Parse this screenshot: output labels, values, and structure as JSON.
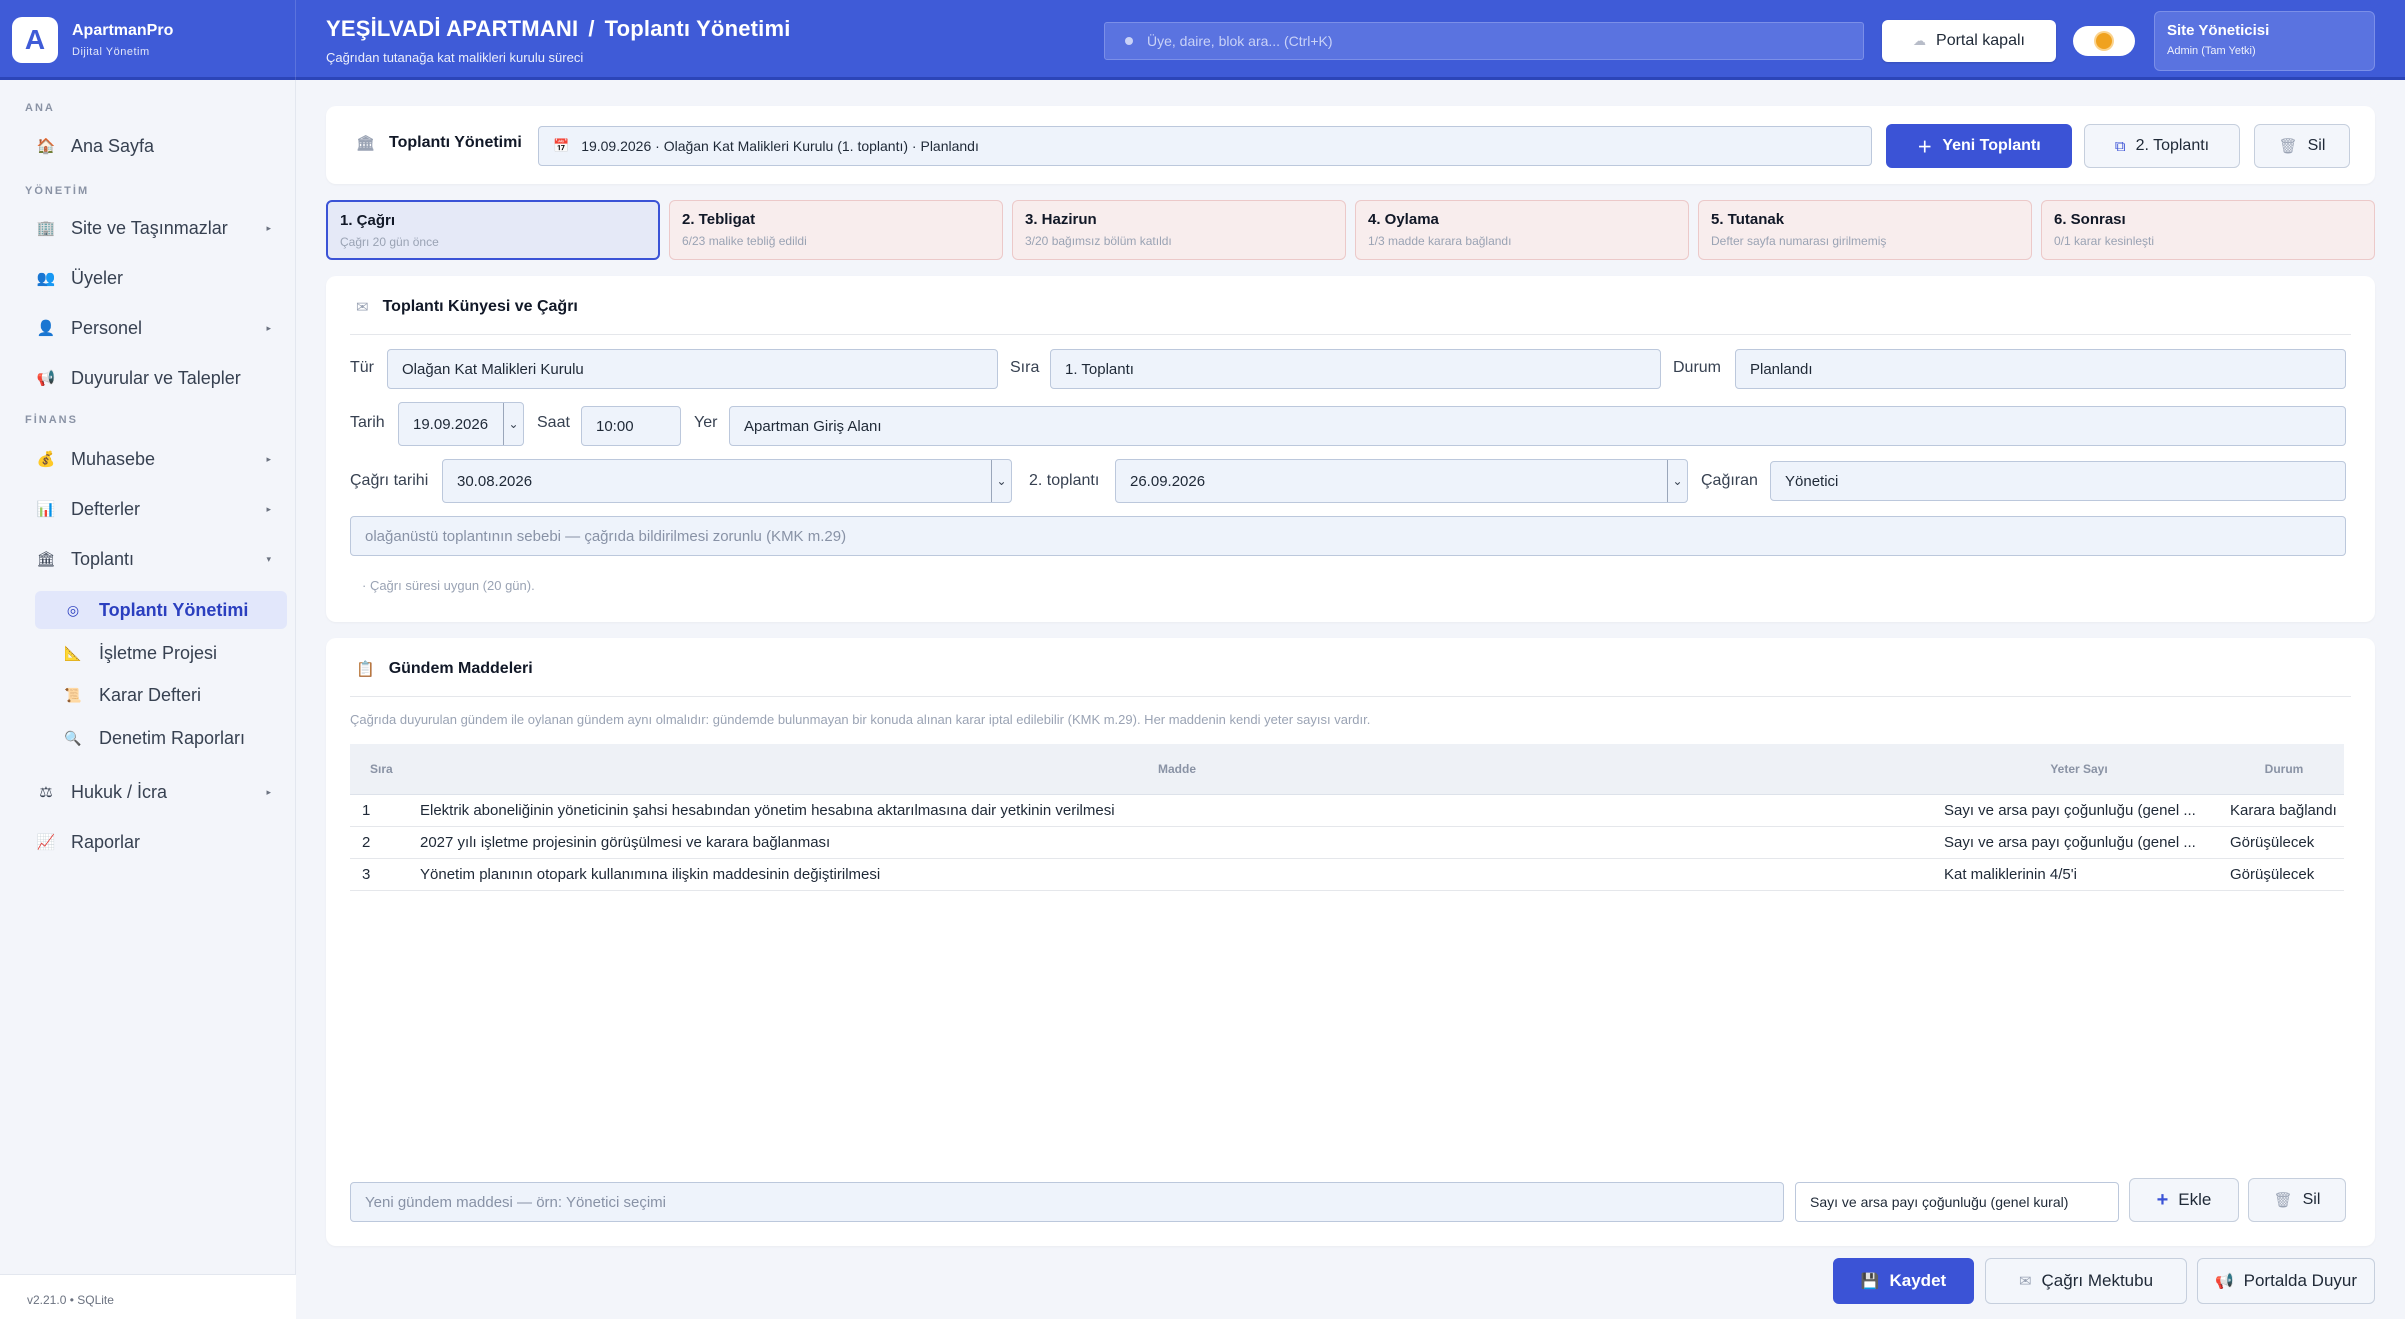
{
  "brand": {
    "logo": "A",
    "name": "ApartmanPro",
    "subtitle": "Dijital Yönetim"
  },
  "header": {
    "title_site": "YEŞİLVADİ APARTMANI",
    "title_sep": "/",
    "title_page": "Toplantı Yönetimi",
    "subtitle": "Çağrıdan tutanağa kat malikleri kurulu süreci",
    "search_placeholder": "Üye, daire, blok ara...  (Ctrl+K)",
    "portal_label": "Portal kapalı",
    "user_name": "Site Yöneticisi",
    "user_role": "Admin (Tam Yetki)"
  },
  "sidebar": {
    "sections": {
      "ana": "ANA",
      "yonetim": "YÖNETİM",
      "finans": "FİNANS"
    },
    "items": [
      {
        "label": "Ana Sayfa",
        "icon": "home-icon",
        "glyph": "🏠"
      },
      {
        "label": "Site ve Taşınmazlar",
        "icon": "building-icon",
        "glyph": "🏢"
      },
      {
        "label": "Üyeler",
        "icon": "users-icon",
        "glyph": "👥"
      },
      {
        "label": "Personel",
        "icon": "staff-icon",
        "glyph": "👤"
      },
      {
        "label": "Duyurular ve Talepler",
        "icon": "megaphone-icon",
        "glyph": "📢"
      },
      {
        "label": "Muhasebe",
        "icon": "money-bag-icon",
        "glyph": "💰"
      },
      {
        "label": "Defterler",
        "icon": "ledger-icon",
        "glyph": "📊"
      },
      {
        "label": "Toplantı",
        "icon": "meeting-icon",
        "glyph": "🏛"
      },
      {
        "label": "Hukuk / İcra",
        "icon": "law-icon",
        "glyph": "⚖"
      },
      {
        "label": "Raporlar",
        "icon": "chart-icon",
        "glyph": "📈"
      }
    ],
    "sub_items": [
      {
        "label": "Toplantı Yönetimi",
        "glyph": "◎"
      },
      {
        "label": "İşletme Projesi",
        "glyph": "📐"
      },
      {
        "label": "Karar Defteri",
        "glyph": "📜"
      },
      {
        "label": "Denetim Raporları",
        "glyph": "🔍"
      }
    ],
    "version": "v2.21.0  •  SQLite"
  },
  "toolbar": {
    "title": "Toplantı Yönetimi",
    "selected_meeting": "19.09.2026 · Olağan Kat Malikleri Kurulu (1. toplantı) · Planlandı",
    "new_label": "Yeni Toplantı",
    "second_label": "2. Toplantı",
    "delete_label": "Sil"
  },
  "steps": [
    {
      "title": "1. Çağrı",
      "sub": "Çağrı 20 gün önce"
    },
    {
      "title": "2. Tebligat",
      "sub": "6/23 malike tebliğ edildi"
    },
    {
      "title": "3. Hazirun",
      "sub": "3/20 bağımsız bölüm katıldı"
    },
    {
      "title": "4. Oylama",
      "sub": "1/3 madde karara bağlandı"
    },
    {
      "title": "5. Tutanak",
      "sub": "Defter sayfa numarası girilmemiş"
    },
    {
      "title": "6. Sonrası",
      "sub": "0/1 karar kesinleşti"
    }
  ],
  "kunye": {
    "title": "Toplantı Künyesi ve Çağrı",
    "tur_label": "Tür",
    "tur": "Olağan Kat Malikleri Kurulu",
    "sira_label": "Sıra",
    "sira": "1. Toplantı",
    "durum_label": "Durum",
    "durum": "Planlandı",
    "tarih_label": "Tarih",
    "tarih": "19.09.2026",
    "saat_label": "Saat",
    "saat": "10:00",
    "yer_label": "Yer",
    "yer": "Apartman Giriş Alanı",
    "cagri_tarihi_label": "Çağrı tarihi",
    "cagri_tarihi": "30.08.2026",
    "ikinci_label": "2. toplantı",
    "ikinci": "26.09.2026",
    "cagiran_label": "Çağıran",
    "cagiran": "Yönetici",
    "sebep_placeholder": "olağanüstü toplantının sebebi — çağrıda bildirilmesi zorunlu (KMK m.29)",
    "note": "· Çağrı süresi uygun (20 gün)."
  },
  "gundem": {
    "title": "Gündem Maddeleri",
    "note": "Çağrıda duyurulan gündem ile oylanan gündem aynı olmalıdır: gündemde bulunmayan bir konuda alınan karar iptal edilebilir (KMK m.29). Her maddenin kendi yeter sayısı vardır.",
    "columns": [
      "Sıra",
      "Madde",
      "Yeter Sayı",
      "Durum"
    ],
    "rows": [
      {
        "sira": "1",
        "madde": "Elektrik aboneliğinin yöneticinin şahsi hesabından yönetim hesabına aktarılmasına dair yetkinin verilmesi",
        "yeter": "Sayı ve arsa payı çoğunluğu (genel ...",
        "durum": "Karara bağlandı"
      },
      {
        "sira": "2",
        "madde": "2027 yılı işletme projesinin görüşülmesi ve karara bağlanması",
        "yeter": "Sayı ve arsa payı çoğunluğu (genel ...",
        "durum": "Görüşülecek"
      },
      {
        "sira": "3",
        "madde": "Yönetim planının otopark kullanımına ilişkin maddesinin değiştirilmesi",
        "yeter": "Kat maliklerinin 4/5'i",
        "durum": "Görüşülecek"
      }
    ],
    "new_placeholder": "Yeni gündem maddesi — örn: Yönetici seçimi",
    "yeter_select": "Sayı ve arsa payı çoğunluğu (genel kural)",
    "add_label": "Ekle",
    "delete_label": "Sil"
  },
  "footer": {
    "save_label": "Kaydet",
    "letter_label": "Çağrı Mektubu",
    "announce_label": "Portalda Duyur"
  },
  "colors": {
    "accent": "#3b53d6",
    "header": "#3f5bd7",
    "success": "#22a96a"
  }
}
